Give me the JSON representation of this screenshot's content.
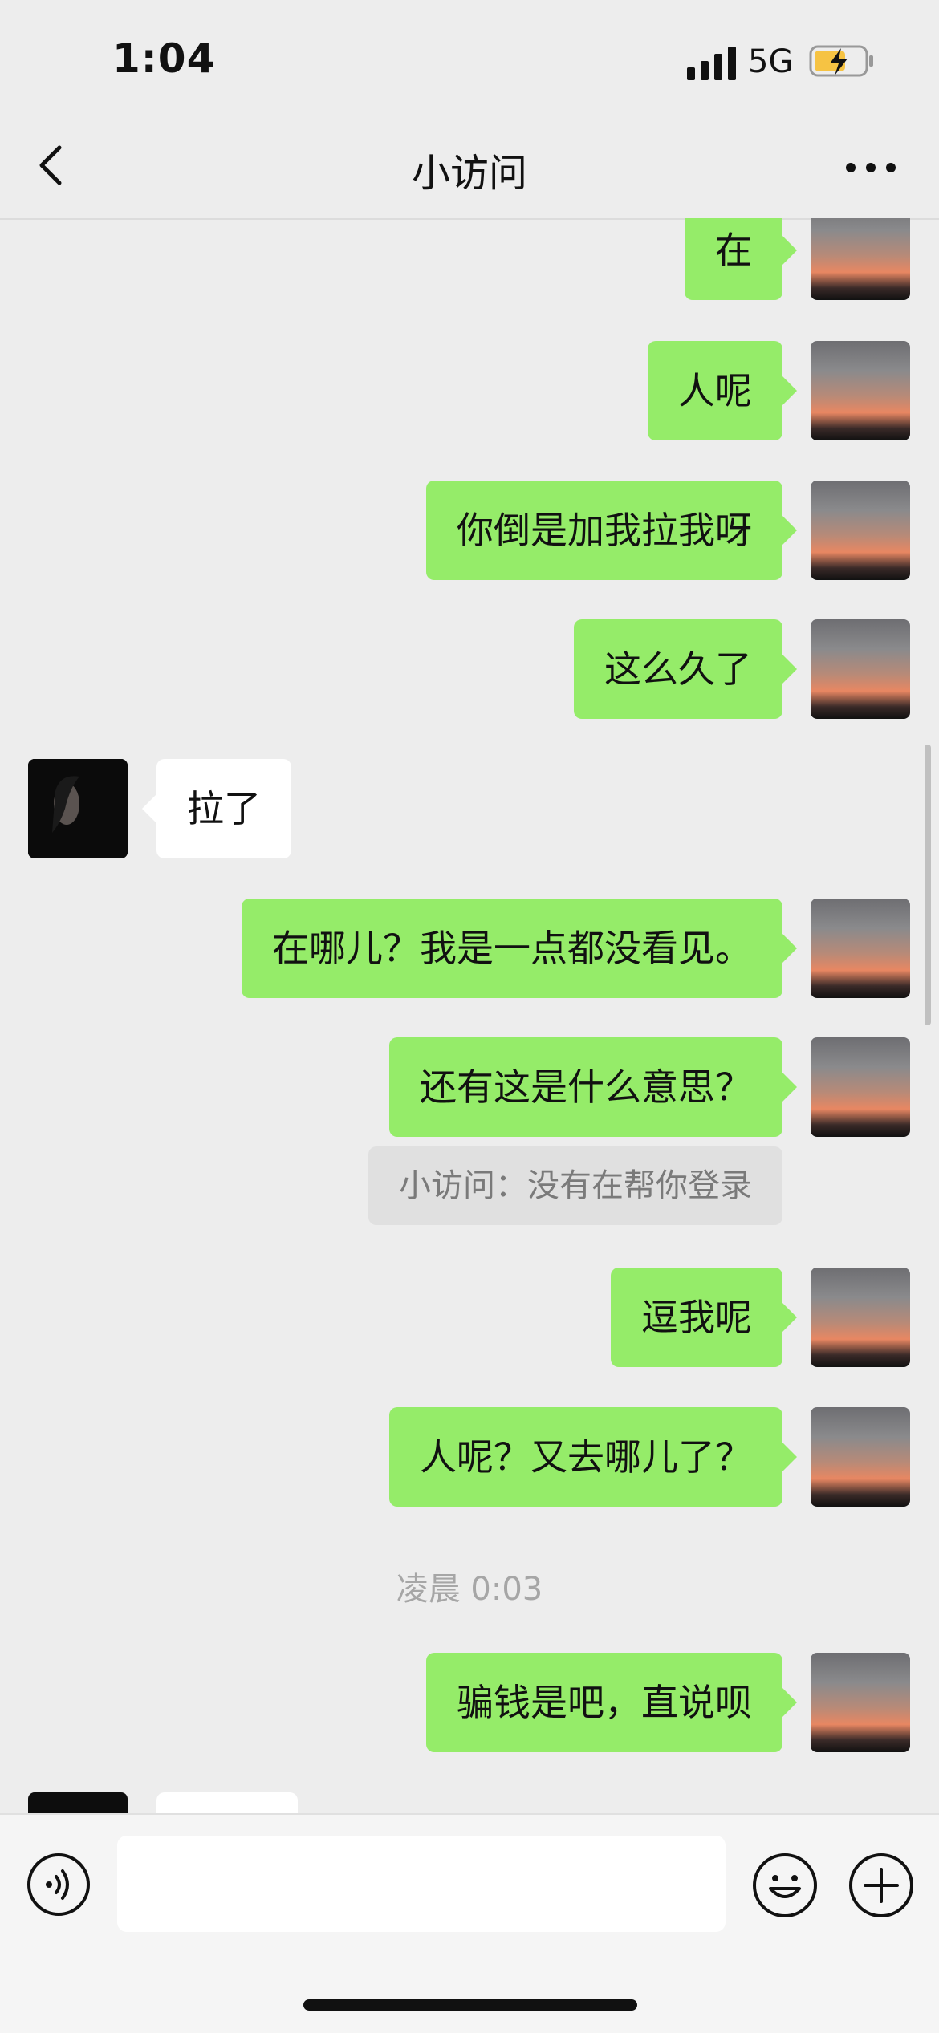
{
  "status_bar": {
    "time": "1:04",
    "network": "5G"
  },
  "header": {
    "title": "小访问"
  },
  "messages": [
    {
      "side": "me",
      "text": "在"
    },
    {
      "side": "me",
      "text": "人呢"
    },
    {
      "side": "me",
      "text": "你倒是加我拉我呀"
    },
    {
      "side": "me",
      "text": "这么久了"
    },
    {
      "side": "other",
      "text": "拉了"
    },
    {
      "side": "me",
      "text": "在哪儿？我是一点都没看见。"
    },
    {
      "side": "me",
      "text": "还有这是什么意思？",
      "quote": "小访问：没有在帮你登录"
    },
    {
      "side": "me",
      "text": "逗我呢"
    },
    {
      "side": "me",
      "text": "人呢？又去哪儿了？"
    },
    {
      "type": "timestamp",
      "text": "凌晨 0:03"
    },
    {
      "side": "me",
      "text": "骗钱是吧，直说呗"
    }
  ],
  "input": {
    "value": "",
    "placeholder": ""
  },
  "colors": {
    "my_bubble": "#95ec69",
    "other_bubble": "#ffffff",
    "background": "#ededed"
  }
}
